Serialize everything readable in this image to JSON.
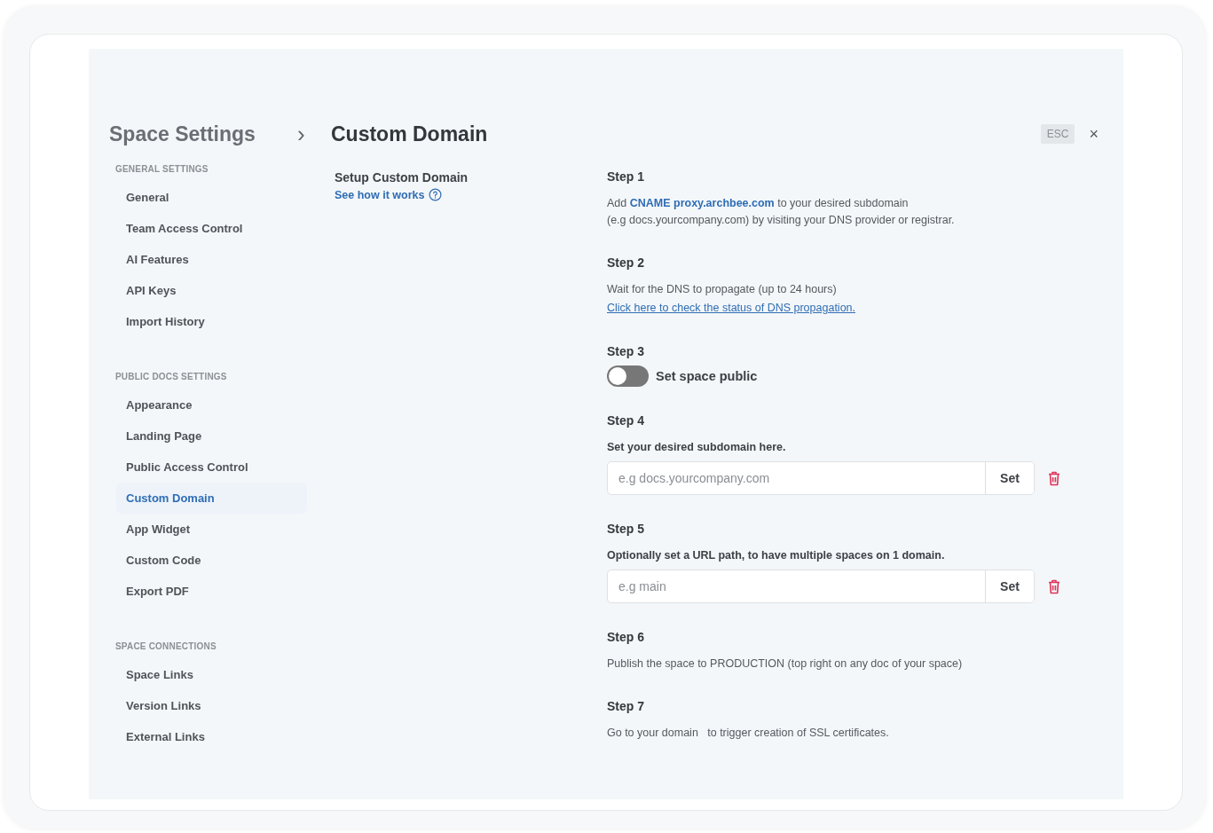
{
  "header": {
    "parent": "Space Settings",
    "separator": "›",
    "title": "Custom Domain",
    "esc": "ESC",
    "close": "×"
  },
  "sidebar": {
    "sections": [
      {
        "heading": "GENERAL SETTINGS",
        "items": [
          {
            "label": "General",
            "selected": false
          },
          {
            "label": "Team Access Control",
            "selected": false
          },
          {
            "label": "AI Features",
            "selected": false
          },
          {
            "label": "API Keys",
            "selected": false
          },
          {
            "label": "Import History",
            "selected": false
          }
        ]
      },
      {
        "heading": "PUBLIC DOCS SETTINGS",
        "items": [
          {
            "label": "Appearance",
            "selected": false
          },
          {
            "label": "Landing Page",
            "selected": false
          },
          {
            "label": "Public Access Control",
            "selected": false
          },
          {
            "label": "Custom Domain",
            "selected": true
          },
          {
            "label": "App Widget",
            "selected": false
          },
          {
            "label": "Custom Code",
            "selected": false
          },
          {
            "label": "Export PDF",
            "selected": false
          }
        ]
      },
      {
        "heading": "SPACE CONNECTIONS",
        "items": [
          {
            "label": "Space Links",
            "selected": false
          },
          {
            "label": "Version Links",
            "selected": false
          },
          {
            "label": "External Links",
            "selected": false
          }
        ]
      }
    ]
  },
  "intro": {
    "title": "Setup Custom Domain",
    "link": "See how it works"
  },
  "steps": [
    {
      "title": "Step 1",
      "items": [
        {
          "kind": "text",
          "text": "Add **CNAME proxy.archbee.com** to your desired subdomain"
        },
        {
          "kind": "text",
          "text": "(e.g docs.yourcompany.com) by visiting your DNS provider or registrar."
        }
      ]
    },
    {
      "title": "Step 2",
      "items": [
        {
          "kind": "text",
          "text": "Wait for the DNS to propagate (up to 24 hours)"
        },
        {
          "kind": "link",
          "text": "Click here to check the status of DNS propagation."
        }
      ]
    },
    {
      "title": "Step 3",
      "items": [
        {
          "kind": "toggle",
          "label": "Set space public",
          "on": false
        }
      ]
    },
    {
      "title": "Step 4",
      "items": [
        {
          "kind": "label",
          "text": "Set your desired subdomain here."
        },
        {
          "kind": "input",
          "placeholder": "e.g docs.yourcompany.com",
          "button": "Set"
        }
      ]
    },
    {
      "title": "Step 5",
      "items": [
        {
          "kind": "label",
          "text": "Optionally set a URL path, to have multiple spaces on 1 domain."
        },
        {
          "kind": "input",
          "placeholder": "e.g main",
          "button": "Set"
        }
      ]
    },
    {
      "title": "Step 6",
      "items": [
        {
          "kind": "text",
          "text": "Publish the space to PRODUCTION (top right on any doc of your space)"
        }
      ]
    },
    {
      "title": "Step 7",
      "items": [
        {
          "kind": "text",
          "text": "Go to your domain   to trigger creation of SSL certificates."
        }
      ]
    }
  ]
}
